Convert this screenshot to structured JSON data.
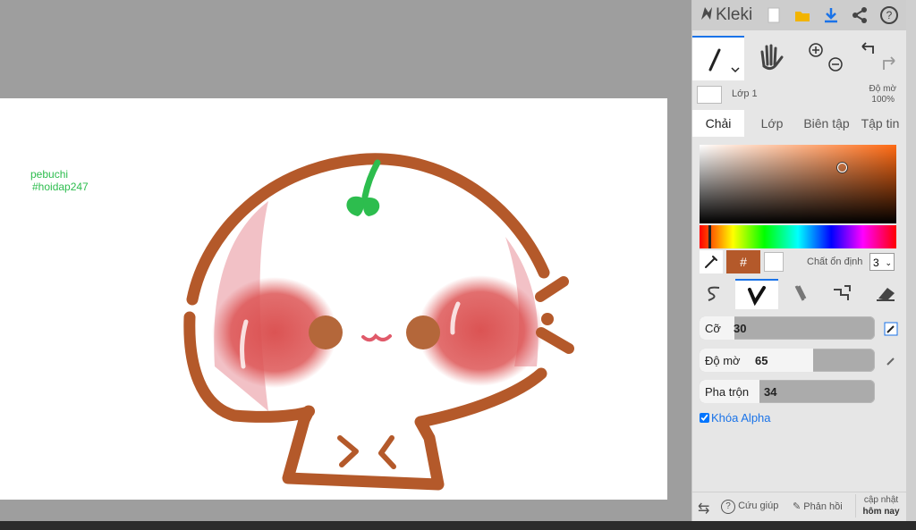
{
  "canvas": {
    "watermark_line1": "pebuchi",
    "watermark_line2": "#hoidap247"
  },
  "app": {
    "name": "Kleki",
    "toolbar_icons": [
      "new-image-icon",
      "open-folder-icon",
      "download-icon",
      "share-icon",
      "help-icon"
    ]
  },
  "layer": {
    "name": "Lớp 1",
    "opacity_label": "Độ mờ",
    "opacity_value": "100%"
  },
  "tabs": [
    "Chải",
    "Lớp",
    "Biên tập",
    "Tập tin"
  ],
  "color": {
    "primary": "#b4592a",
    "secondary": "#ffffff",
    "hex_symbol": "#",
    "stabilizer_label": "Chất ổn định",
    "stabilizer_value": "3"
  },
  "brush": {
    "size_label": "Cỡ",
    "size_value": "30",
    "size_fraction": 0.2,
    "opacity_label": "Độ mờ",
    "opacity_value": "65",
    "opacity_fraction": 0.65,
    "blend_label": "Pha trộn",
    "blend_value": "34",
    "blend_fraction": 0.34,
    "alpha_lock_label": "Khóa Alpha",
    "alpha_lock_checked": true
  },
  "footer": {
    "help": "Cứu giúp",
    "feedback": "Phản hồi",
    "update_line1": "cập nhật",
    "update_line2": "hôm nay"
  }
}
